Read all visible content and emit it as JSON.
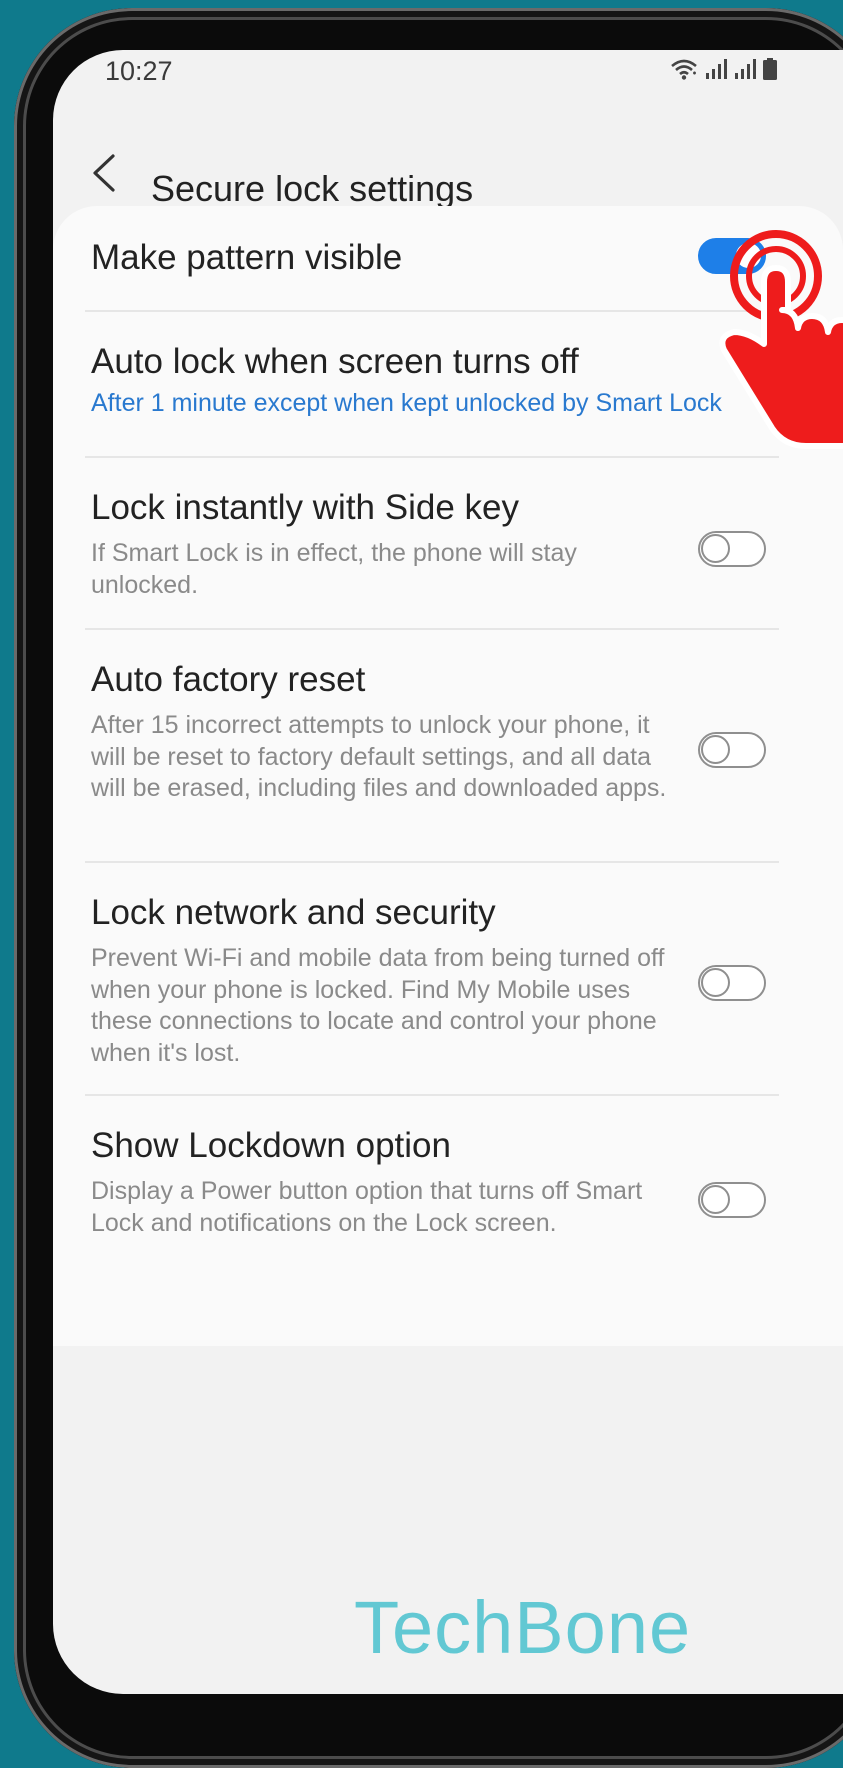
{
  "status_bar": {
    "time": "10:27",
    "icons": [
      "wifi-icon",
      "signal-icon",
      "signal-icon",
      "battery-icon"
    ]
  },
  "header": {
    "back_icon": "chevron-left-icon",
    "title": "Secure lock settings"
  },
  "settings": [
    {
      "title": "Make pattern visible",
      "subtitle": "",
      "toggle": true
    },
    {
      "title": "Auto lock when screen turns off",
      "subtitle": "After 1 minute except when kept unlocked by Smart Lock"
    },
    {
      "title": "Lock instantly with Side key",
      "subtitle": "If Smart Lock is in effect, the phone will stay unlocked.",
      "toggle": false
    },
    {
      "title": "Auto factory reset",
      "subtitle": "After 15 incorrect attempts to unlock your phone, it will be reset to factory default settings, and all data will be erased, including files and downloaded apps.",
      "toggle": false
    },
    {
      "title": "Lock network and security",
      "subtitle": "Prevent Wi-Fi and mobile data from being turned off when your phone is locked. Find My Mobile uses these connections to locate and control your phone when it's lost.",
      "toggle": false
    },
    {
      "title": "Show Lockdown option",
      "subtitle": "Display a Power button option that turns off Smart Lock and notifications on the Lock screen.",
      "toggle": false
    }
  ],
  "watermark": "TechBone",
  "overlay_icon": "tap-hand-icon",
  "colors": {
    "background": "#0f7a8c",
    "accent": "#1e7fe8",
    "link": "#2979cf",
    "watermark": "#62c8d3",
    "hand": "#ee1c1c"
  }
}
